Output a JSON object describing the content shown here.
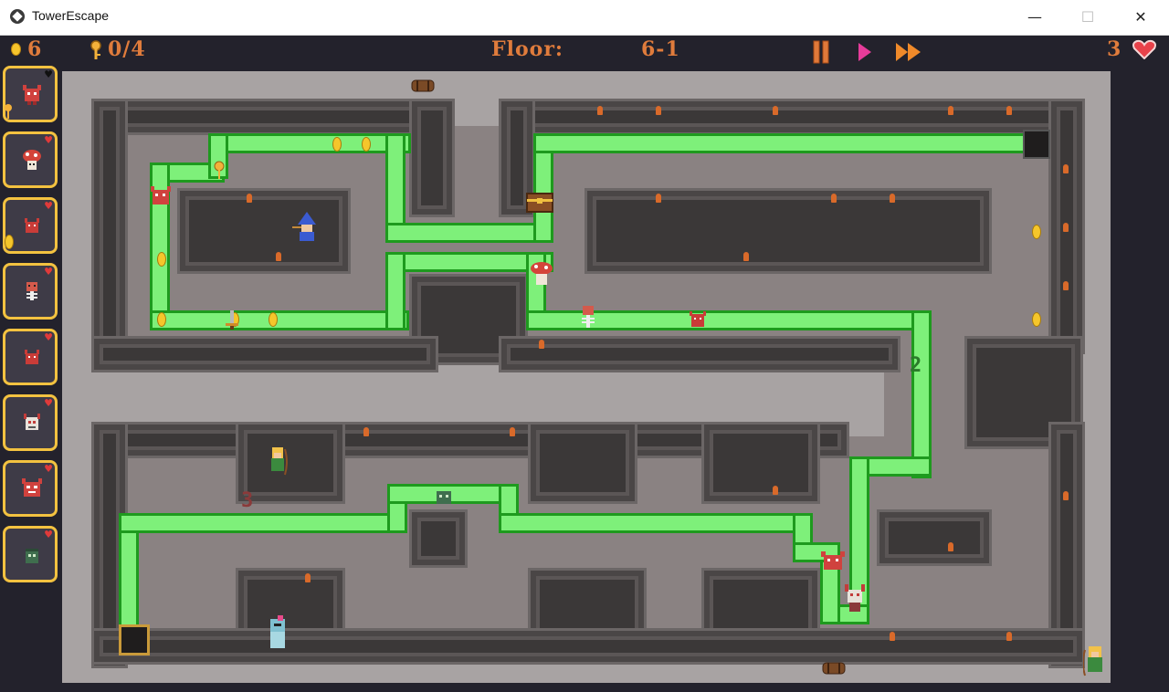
{
  "window": {
    "title": "TowerEscape",
    "minimize": "—",
    "maximize": "☐",
    "close": "✕"
  },
  "hud": {
    "coins": "6",
    "keys": "0/4",
    "floor_label": "Floor:",
    "floor_value": "6-1",
    "lives": "3",
    "controls": [
      "pause-icon",
      "play-icon",
      "fast-forward-icon"
    ],
    "accent_color": "#e07c3c"
  },
  "roster": [
    {
      "creature": "red-imp-icon",
      "heart": "black",
      "has_key": true
    },
    {
      "creature": "mushroom-icon",
      "heart": "red"
    },
    {
      "creature": "red-imp-icon",
      "heart": "red",
      "has_coin": true
    },
    {
      "creature": "skeleton-icon",
      "heart": "red"
    },
    {
      "creature": "red-imp-icon",
      "heart": "red"
    },
    {
      "creature": "horned-skull-icon",
      "heart": "red"
    },
    {
      "creature": "red-imp-icon",
      "heart": "red"
    },
    {
      "creature": "green-zombie-icon",
      "heart": "red"
    }
  ],
  "map": {
    "path_numbers": [
      "2",
      "3"
    ],
    "colors": {
      "path_fill": "#7ef07a",
      "path_border": "#1e9a1e",
      "wall": "#3b3838",
      "floor": "#8a8282",
      "stone": "#a8a3a3"
    }
  }
}
